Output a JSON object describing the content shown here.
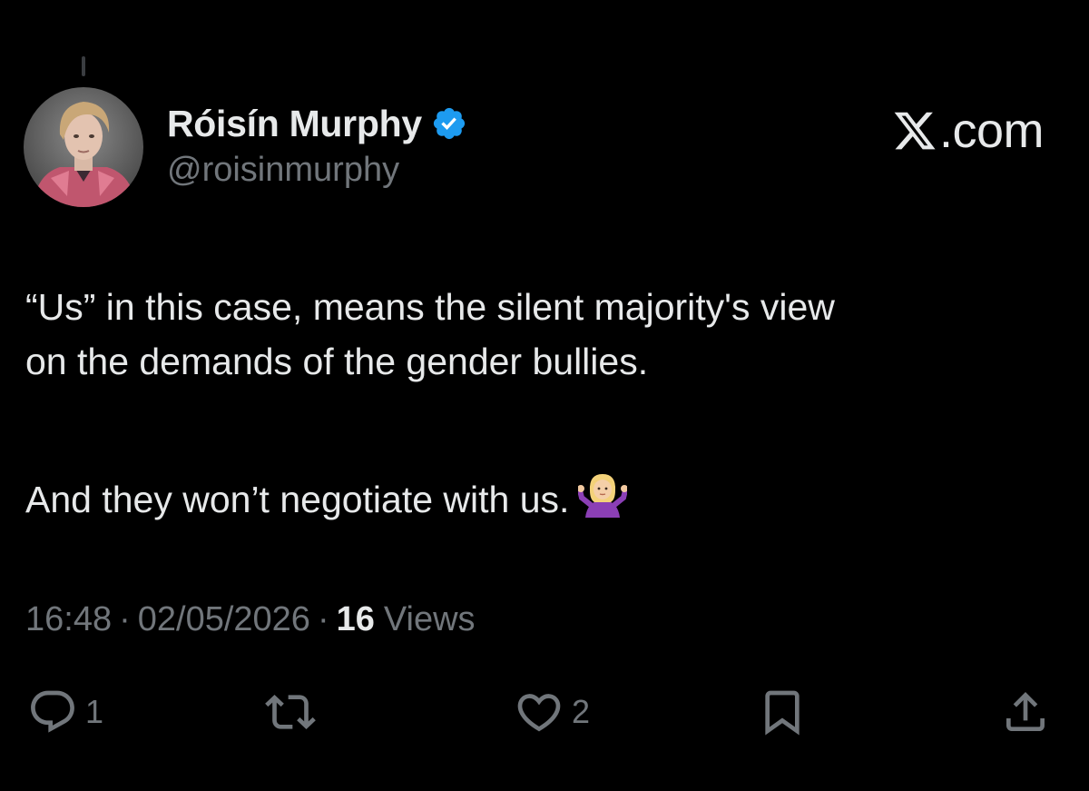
{
  "post": {
    "author": {
      "display_name": "Róisín Murphy",
      "handle": "@roisinmurphy",
      "verified": true,
      "verified_color": "#1d9bf0"
    },
    "brand": {
      "logo_icon": "x-logo-icon",
      "domain": ".com"
    },
    "text_lines": [
      "“Us” in this case, means the silent majority's view",
      "on the demands of the gender bullies.",
      "And they won’t negotiate with us."
    ],
    "emoji": "person-shrugging-emoji",
    "time": "16:48",
    "separator": "·",
    "date": "02/05/2026",
    "views_count": "16",
    "views_label": "Views",
    "actions": {
      "reply_count": "1",
      "repost_count": "",
      "like_count": "2"
    }
  },
  "colors": {
    "background": "#000000",
    "primary_text": "#e7e9ea",
    "secondary_text": "#71767b"
  }
}
